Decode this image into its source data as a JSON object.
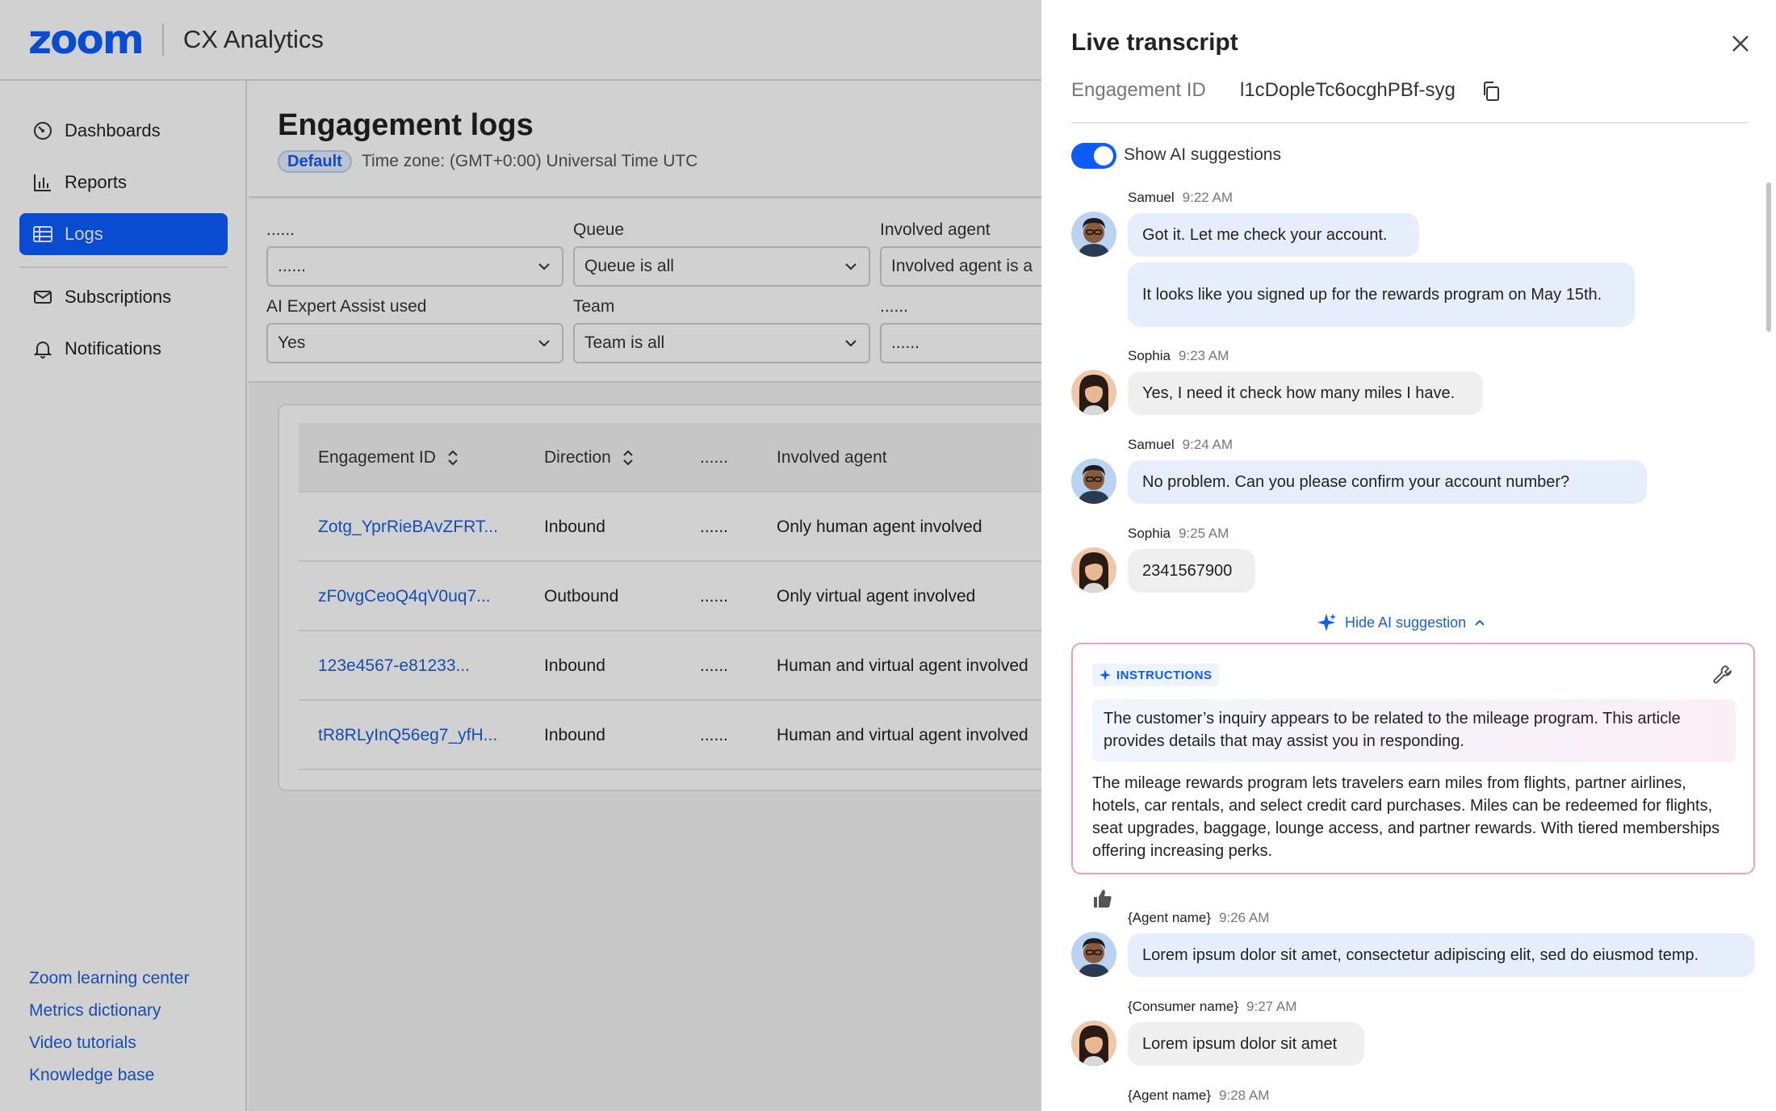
{
  "header": {
    "logo": "zoom",
    "app_name": "CX Analytics"
  },
  "sidebar": {
    "items": [
      {
        "label": "Dashboards",
        "icon": "dashboard-icon"
      },
      {
        "label": "Reports",
        "icon": "bar-chart-icon"
      },
      {
        "label": "Logs",
        "icon": "table-icon",
        "active": true
      },
      {
        "label": "Subscriptions",
        "icon": "envelope-icon"
      },
      {
        "label": "Notifications",
        "icon": "bell-icon"
      }
    ],
    "links": [
      "Zoom learning center",
      "Metrics dictionary",
      "Video tutorials",
      "Knowledge base"
    ]
  },
  "page": {
    "title": "Engagement logs",
    "badge": "Default",
    "timezone": "Time zone: (GMT+0:00) Universal Time UTC"
  },
  "filters": [
    {
      "label": "......",
      "value": "......"
    },
    {
      "label": "Queue",
      "value": "Queue is all"
    },
    {
      "label": "Involved agent",
      "value": "Involved agent is a"
    },
    {
      "label": "AI Expert Assist used",
      "value": "Yes"
    },
    {
      "label": "Team",
      "value": "Team is all"
    },
    {
      "label": "......",
      "value": "......"
    }
  ],
  "table": {
    "headers": [
      "Engagement ID",
      "Direction",
      "......",
      "Involved agent"
    ],
    "rows": [
      [
        "Zotg_YprRieBAvZFRT...",
        "Inbound",
        "......",
        "Only human agent involved"
      ],
      [
        "zF0vgCeoQ4qV0uq7...",
        "Outbound",
        "......",
        "Only virtual agent involved"
      ],
      [
        "123e4567-e81233...",
        "Inbound",
        "......",
        "Human and virtual agent involved"
      ],
      [
        "tR8RLyInQ56eg7_yfH...",
        "Inbound",
        "......",
        "Human and virtual agent involved"
      ]
    ]
  },
  "transcript": {
    "title": "Live transcript",
    "engagement_label": "Engagement ID",
    "engagement_id": "l1cDopleTc6ocghPBf-syg",
    "toggle_label": "Show AI suggestions",
    "toggle_on": true,
    "messages": [
      {
        "name": "Samuel",
        "time": "9:22 AM",
        "text": "Got it. Let me check your account.",
        "role": "agent"
      },
      {
        "text": "It looks like you signed up for the rewards program on May 15th.",
        "role": "agent"
      },
      {
        "name": "Sophia",
        "time": "9:23 AM",
        "text": "Yes, I need it check how many miles I have.",
        "role": "customer"
      },
      {
        "name": "Samuel",
        "time": "9:24 AM",
        "text": "No problem. Can you please confirm your account number?",
        "role": "agent"
      },
      {
        "name": "Sophia",
        "time": "9:25 AM",
        "text": "2341567900",
        "role": "customer"
      },
      {
        "name": "{Agent name}",
        "time": "9:26 AM",
        "text": "Lorem ipsum dolor sit amet, consectetur adipiscing elit, sed do eiusmod temp.",
        "role": "agent"
      },
      {
        "name": "{Consumer name}",
        "time": "9:27 AM",
        "text": "Lorem ipsum dolor sit amet",
        "role": "customer"
      },
      {
        "name": "{Agent name}",
        "time": "9:28 AM",
        "role": "agent"
      }
    ],
    "hide_ai_label": "Hide AI suggestion",
    "ai": {
      "tag": "INSTRUCTIONS",
      "intro": "The customer’s inquiry appears to be related to the mileage program. This article provides details that may assist you in responding.",
      "body": "The mileage rewards program lets travelers earn miles from flights, partner airlines, hotels, car rentals, and select credit card purchases. Miles can be redeemed for flights, seat upgrades, baggage, lounge access, and partner rewards. With tiered memberships offering increasing perks."
    }
  },
  "colors": {
    "brand": "#0b5cff",
    "link": "#1a5fd8",
    "agent_bubble": "#e6eefc",
    "customer_bubble": "#efefef",
    "ai_border": "#e9a0cc"
  }
}
